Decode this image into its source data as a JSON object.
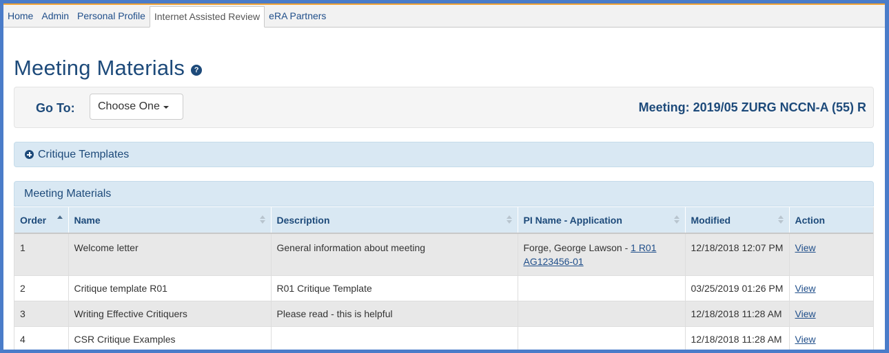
{
  "colors": {
    "accent": "#1d4a7a",
    "panel": "#d9e8f3",
    "top_border": "#f0a030",
    "frame": "#4a7cc9"
  },
  "nav": {
    "tabs": [
      {
        "label": "Home",
        "active": false
      },
      {
        "label": "Admin",
        "active": false
      },
      {
        "label": "Personal Profile",
        "active": false
      },
      {
        "label": "Internet Assisted Review",
        "active": true
      },
      {
        "label": "eRA Partners",
        "active": false
      }
    ]
  },
  "page": {
    "title": "Meeting Materials",
    "help_icon": "question-circle-icon"
  },
  "goto": {
    "label": "Go To:",
    "dropdown_value": "Choose One",
    "meeting": "Meeting: 2019/05 ZURG NCCN-A (55) R"
  },
  "critique_panel": {
    "label": "Critique Templates",
    "icon": "plus-circle-icon"
  },
  "materials_panel": {
    "label": "Meeting Materials"
  },
  "table": {
    "headers": [
      "Order",
      "Name",
      "Description",
      "PI Name - Application",
      "Modified",
      "Action"
    ],
    "rows": [
      {
        "order": "1",
        "name": "Welcome letter",
        "description": "General information about meeting",
        "pi_name": "Forge, George Lawson - ",
        "application": "1 R01 AG123456-01",
        "modified": "12/18/2018 12:07 PM",
        "action": "View"
      },
      {
        "order": "2",
        "name": "Critique template R01",
        "description": "R01 Critique Template",
        "pi_name": "",
        "application": "",
        "modified": "03/25/2019 01:26 PM",
        "action": "View"
      },
      {
        "order": "3",
        "name": "Writing Effective Critiquers",
        "description": "Please read - this is helpful",
        "pi_name": "",
        "application": "",
        "modified": "12/18/2018 11:28 AM",
        "action": "View"
      },
      {
        "order": "4",
        "name": "CSR Critique Examples",
        "description": "",
        "pi_name": "",
        "application": "",
        "modified": "12/18/2018 11:28 AM",
        "action": "View"
      }
    ]
  }
}
